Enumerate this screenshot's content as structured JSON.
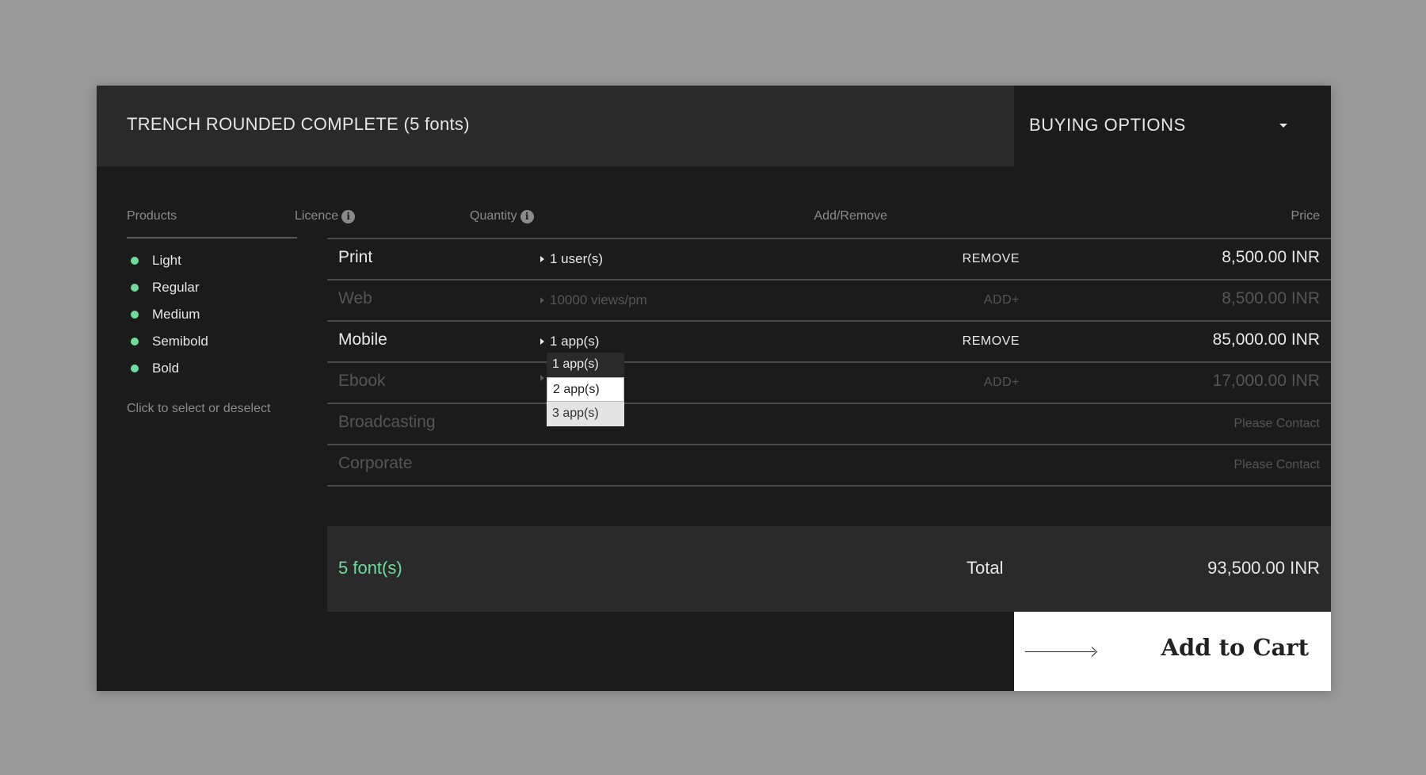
{
  "header": {
    "title": "TRENCH ROUNDED COMPLETE (5 fonts)",
    "buying_options": "BUYING OPTIONS"
  },
  "products": {
    "heading": "Products",
    "items": [
      "Light",
      "Regular",
      "Medium",
      "Semibold",
      "Bold"
    ],
    "hint": "Click to select or deselect",
    "dot_color": "#6ddc9c"
  },
  "table": {
    "headers": {
      "licence": "Licence",
      "quantity": "Quantity",
      "add_remove": "Add/Remove",
      "price": "Price"
    },
    "rows": [
      {
        "licence": "Print",
        "quantity": "1 user(s)",
        "action": "REMOVE",
        "price": "8,500.00 INR",
        "active": true
      },
      {
        "licence": "Web",
        "quantity": "10000 views/pm",
        "action": "ADD+",
        "price": "8,500.00 INR",
        "active": false
      },
      {
        "licence": "Mobile",
        "quantity": "1 app(s)",
        "action": "REMOVE",
        "price": "85,000.00 INR",
        "active": true
      },
      {
        "licence": "Ebook",
        "quantity": "",
        "action": "ADD+",
        "price": "17,000.00 INR",
        "active": false
      },
      {
        "licence": "Broadcasting",
        "quantity": "",
        "action": "",
        "price": "Please Contact",
        "active": false
      },
      {
        "licence": "Corporate",
        "quantity": "",
        "action": "",
        "price": "Please Contact",
        "active": false
      }
    ]
  },
  "dropdown": {
    "options": [
      "1 app(s)",
      "2 app(s)",
      "3 app(s)"
    ],
    "selected": "1 app(s)"
  },
  "summary": {
    "fonts_count": "5 font(s)",
    "total_label": "Total",
    "total_value": "93,500.00 INR",
    "accent_color": "#6ddc9c"
  },
  "cart": {
    "label": "Add to Cart"
  }
}
